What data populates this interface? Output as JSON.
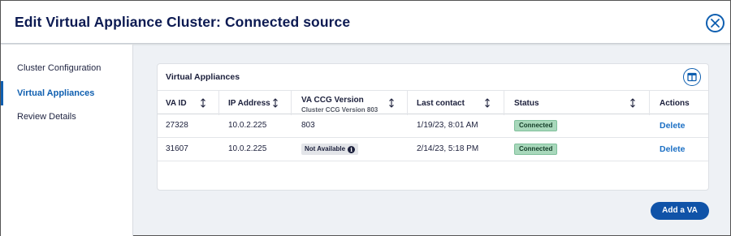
{
  "dialog": {
    "title": "Edit Virtual Appliance Cluster: Connected source",
    "close_icon": "close-icon"
  },
  "sidebar": {
    "items": [
      {
        "label": "Cluster Configuration",
        "active": false
      },
      {
        "label": "Virtual Appliances",
        "active": true
      },
      {
        "label": "Review Details",
        "active": false
      }
    ]
  },
  "card": {
    "title": "Virtual Appliances",
    "columns_icon": "columns-icon"
  },
  "table": {
    "headers": {
      "va_id": "VA ID",
      "ip": "IP Address",
      "version": "VA CCG Version",
      "version_sub": "Cluster CCG Version 803",
      "last_contact": "Last contact",
      "status": "Status",
      "actions": "Actions"
    },
    "rows": [
      {
        "va_id": "27328",
        "ip": "10.0.2.225",
        "version": "803",
        "last_contact": "1/19/23, 8:01 AM",
        "status": "Connected",
        "action": "Delete"
      },
      {
        "va_id": "31607",
        "ip": "10.0.2.225",
        "version": "Not Available",
        "last_contact": "2/14/23, 5:18 PM",
        "status": "Connected",
        "action": "Delete"
      }
    ]
  },
  "footer": {
    "add_button": "Add a VA"
  },
  "colors": {
    "brand": "#0f5fb0",
    "title": "#0c1a52",
    "connected_badge": "#a8d8bb",
    "primary_button": "#1053a8"
  }
}
